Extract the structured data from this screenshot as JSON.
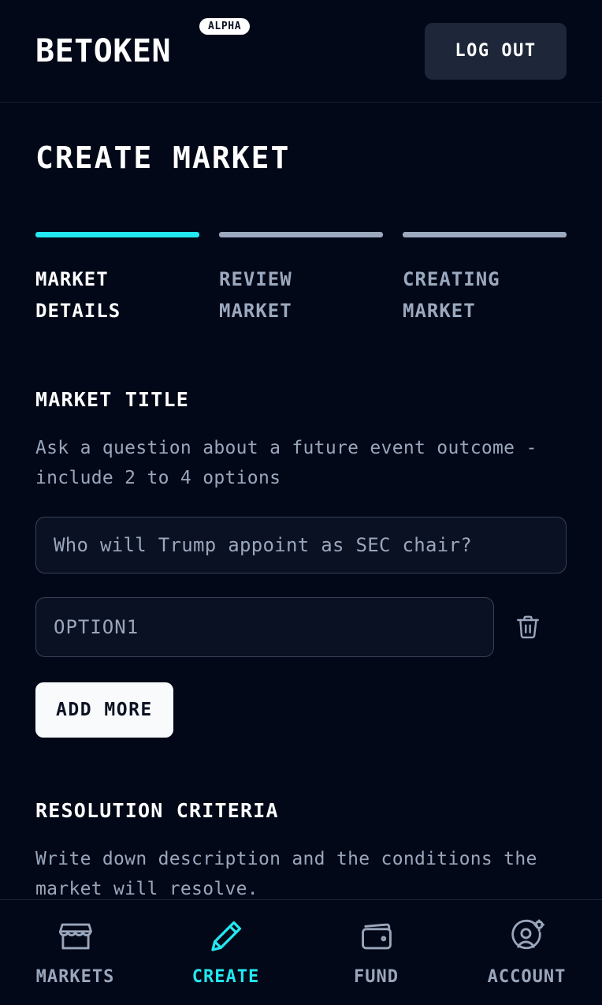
{
  "header": {
    "brand": "BETOKEN",
    "badge": "ALPHA",
    "logout_label": "LOG OUT"
  },
  "page": {
    "title": "CREATE MARKET"
  },
  "stepper": {
    "steps": [
      {
        "label": "MARKET\nDETAILS",
        "active": true
      },
      {
        "label": "REVIEW\nMARKET",
        "active": false
      },
      {
        "label": "CREATING\nMARKET",
        "active": false
      }
    ]
  },
  "market_title_section": {
    "heading": "MARKET TITLE",
    "description": "Ask a question about a future event outcome - include 2 to 4 options",
    "title_input": {
      "value": "",
      "placeholder": "Who will Trump appoint as SEC chair?"
    },
    "option_input": {
      "value": "",
      "placeholder": "OPTION1"
    },
    "delete_icon": "trash-icon",
    "add_more_label": "ADD MORE"
  },
  "resolution_section": {
    "heading": "RESOLUTION CRITERIA",
    "description": "Write down description and the conditions the market will resolve."
  },
  "bottom_nav": {
    "items": [
      {
        "label": "MARKETS",
        "icon": "storefront-icon",
        "active": false
      },
      {
        "label": "CREATE",
        "icon": "pencil-icon",
        "active": true
      },
      {
        "label": "FUND",
        "icon": "wallet-icon",
        "active": false
      },
      {
        "label": "ACCOUNT",
        "icon": "account-gear-icon",
        "active": false
      }
    ]
  },
  "colors": {
    "background": "#020817",
    "accent": "#22e8f0",
    "muted": "#9aa6bc",
    "surface": "#1e2739",
    "white": "#f8fafc"
  }
}
